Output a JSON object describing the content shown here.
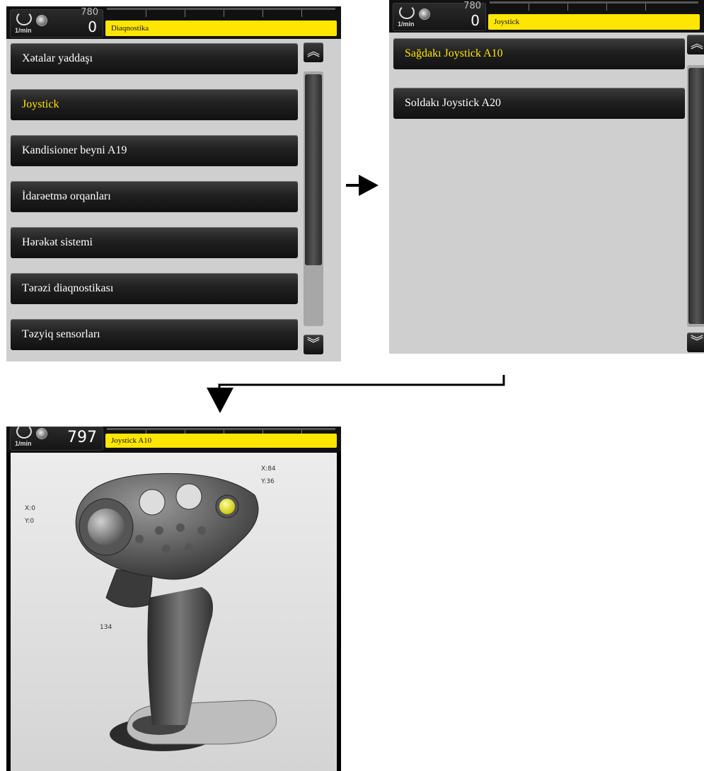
{
  "screen1": {
    "rpm_unit": "1/min",
    "rpm_top": "780",
    "rpm_value": "0",
    "title": "Diaqnostika",
    "items": [
      {
        "label": "Xətalar yaddaşı"
      },
      {
        "label": "Joystick",
        "selected": true
      },
      {
        "label": "Kandisioner beyni A19"
      },
      {
        "label": "İdarəetmə orqanları"
      },
      {
        "label": "Hərəkət sistemi"
      },
      {
        "label": "Tərəzi diaqnostikası"
      },
      {
        "label": "Təzyiq sensorları"
      }
    ]
  },
  "screen2": {
    "rpm_unit": "1/min",
    "rpm_top": "780",
    "rpm_value": "0",
    "title": "Joystick",
    "items": [
      {
        "label": "Sağdakı Joystick A10",
        "selected": true
      },
      {
        "label": "Soldakı Joystick A20"
      }
    ]
  },
  "screen3": {
    "rpm_unit": "1/min",
    "rpm_value": "797",
    "title": "Joystick A10",
    "left_x": "X:0",
    "left_y": "Y:0",
    "right_x": "X:84",
    "right_y": "Y:36",
    "wheel_value": "134"
  },
  "icons": {
    "scroll_up": "chevron-double-up-icon",
    "scroll_down": "chevron-double-down-icon",
    "flow_right": "arrow-right-icon",
    "flow_down": "arrow-down-icon"
  },
  "colors": {
    "title_bar": "#ffe600",
    "selected_text": "#ffe600",
    "button": "#1e1e1e",
    "panel_bg": "#cfcfcf"
  }
}
